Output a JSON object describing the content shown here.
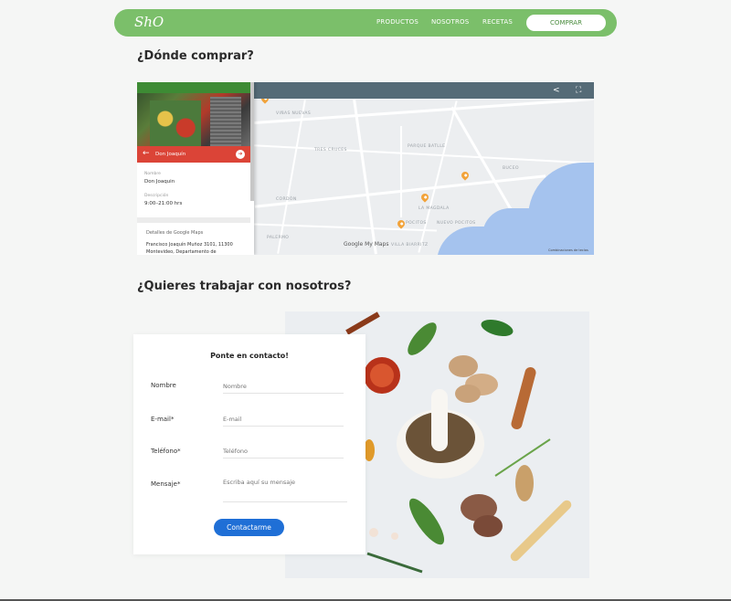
{
  "nav": {
    "logo": "ShO",
    "links": [
      "PRODUCTOS",
      "NOSOTROS",
      "RECETAS"
    ],
    "cta": "COMPRAR",
    "accent_color": "#7bbf6a"
  },
  "where": {
    "heading": "¿Dónde comprar?",
    "map": {
      "panel_title": "Don Joaquín",
      "name_label": "Nombre",
      "name_value": "Don Joaquin",
      "hours_label": "Descripción",
      "hours_value": "9:00–21:00 hrs",
      "details_label": "Detalles de Google Maps",
      "address": "Francisco Joaquín Muñoz 3101, 11300 Montevideo, Departamento de",
      "google_logo": "Google My Maps",
      "credits": "Combinaciones de teclas",
      "labels": [
        "VIÑAS NUEVAS",
        "TRES CRUCES",
        "PARQUE BATLLE",
        "BUCEO",
        "CORDÓN",
        "LA MAGDALA",
        "POCITOS",
        "NUEVO POCITOS",
        "PALERMO",
        "VILLA BIARRITZ"
      ],
      "red_color": "#db4437",
      "pin_color": "#f2a33a"
    }
  },
  "work": {
    "heading": "¿Quieres trabajar con nosotros?",
    "form": {
      "title": "Ponte en contacto!",
      "fields": [
        {
          "label": "Nombre",
          "placeholder": "Nombre"
        },
        {
          "label": "E-mail*",
          "placeholder": "E-mail"
        },
        {
          "label": "Teléfono*",
          "placeholder": "Teléfono"
        },
        {
          "label": "Mensaje*",
          "placeholder": "Escriba aquí su mensaje"
        }
      ],
      "submit": "Contactarme",
      "button_color": "#1f6fd6"
    }
  }
}
